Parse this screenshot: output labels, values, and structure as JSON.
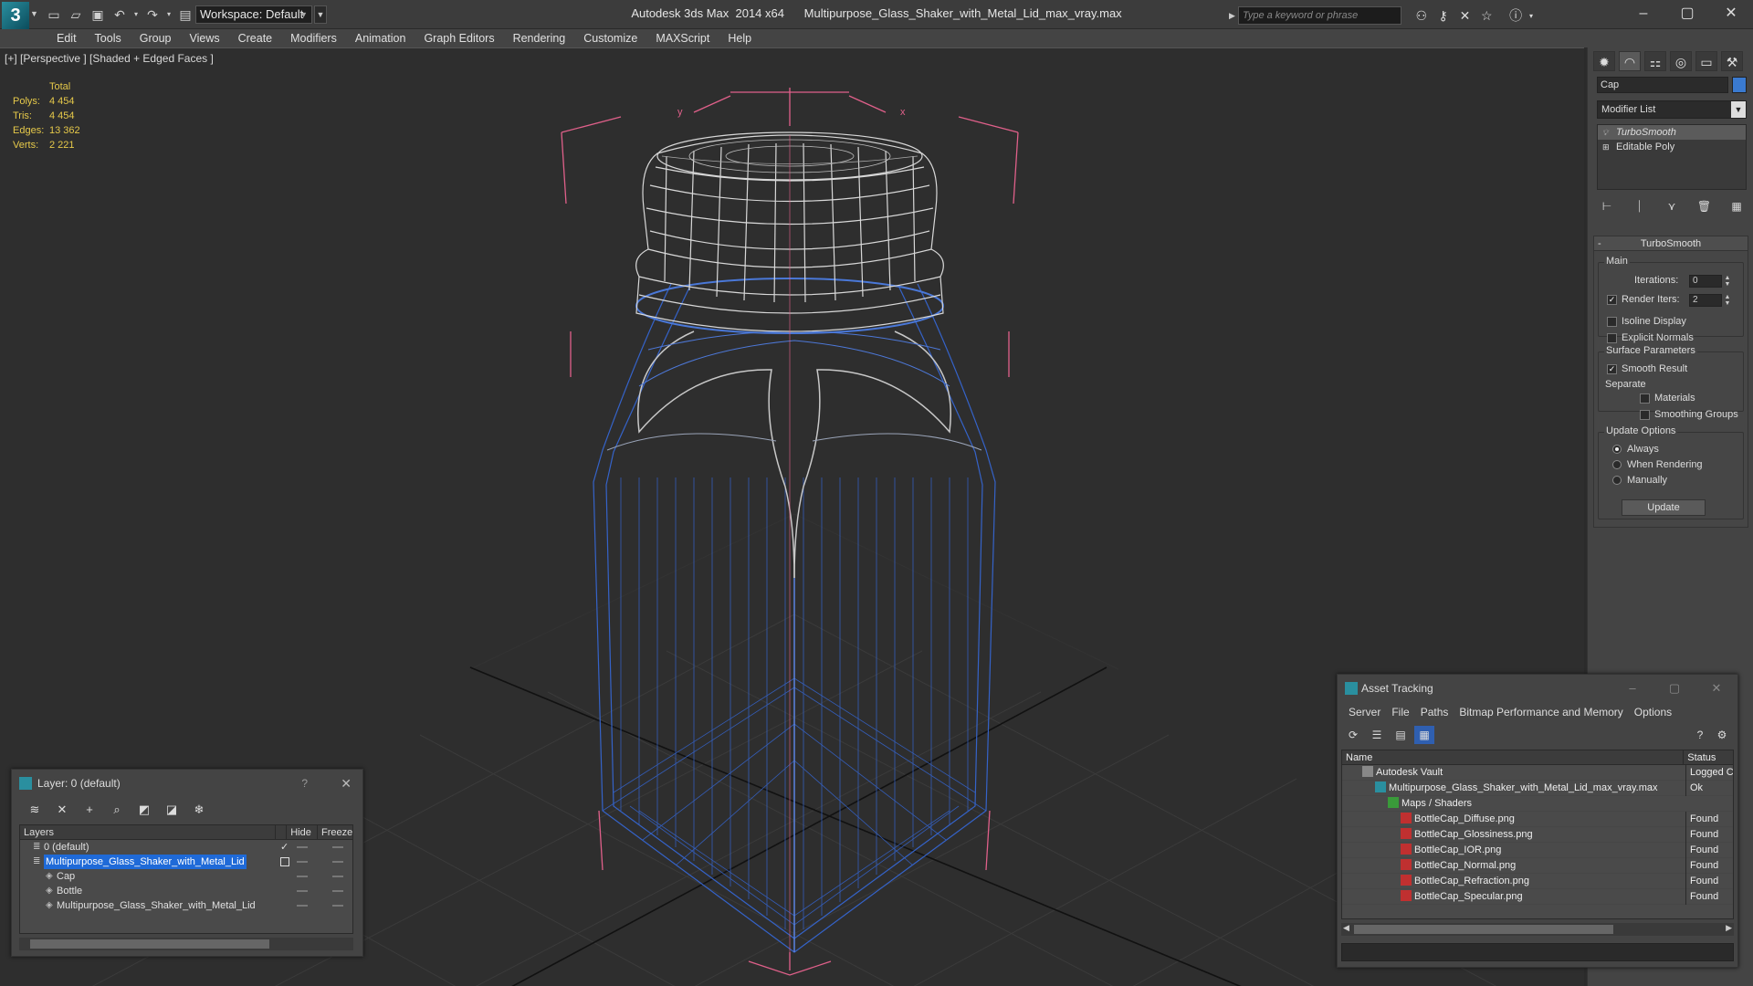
{
  "app": {
    "logo": "3",
    "title": "Autodesk 3ds Max  2014 x64      Multipurpose_Glass_Shaker_with_Metal_Lid_max_vray.max",
    "workspace": "Workspace: Default",
    "search_placeholder": "Type a keyword or phrase"
  },
  "menu": [
    "Edit",
    "Tools",
    "Group",
    "Views",
    "Create",
    "Modifiers",
    "Animation",
    "Graph Editors",
    "Rendering",
    "Customize",
    "MAXScript",
    "Help"
  ],
  "viewport": {
    "label": "[+] [Perspective ] [Shaded + Edged Faces ]",
    "stats": {
      "header": "Total",
      "rows": [
        {
          "k": "Polys:",
          "v": "4 454"
        },
        {
          "k": "Tris:",
          "v": "4 454"
        },
        {
          "k": "Edges:",
          "v": "13 362"
        },
        {
          "k": "Verts:",
          "v": "2 221"
        }
      ]
    },
    "axis_x": "x",
    "axis_y": "y"
  },
  "command_panel": {
    "object_name": "Cap",
    "modifier_list": "Modifier List",
    "stack": [
      "TurboSmooth",
      "Editable Poly"
    ],
    "turbosmooth": {
      "title": "TurboSmooth",
      "main": "Main",
      "iterations_label": "Iterations:",
      "iterations": "0",
      "render_iters_label": "Render Iters:",
      "render_iters": "2",
      "isoline": "Isoline Display",
      "explicit": "Explicit Normals",
      "surface": "Surface Parameters",
      "smooth_result": "Smooth Result",
      "separate": "Separate",
      "materials": "Materials",
      "smoothing_groups": "Smoothing Groups",
      "update_options": "Update Options",
      "always": "Always",
      "when_rendering": "When Rendering",
      "manually": "Manually",
      "update": "Update"
    }
  },
  "layer_dialog": {
    "title": "Layer: 0 (default)",
    "help": "?",
    "columns": [
      "Layers",
      "Hide",
      "Freeze"
    ],
    "rows": [
      {
        "name": "0 (default)",
        "indent": 1
      },
      {
        "name": "Multipurpose_Glass_Shaker_with_Metal_Lid",
        "indent": 1,
        "selected": true
      },
      {
        "name": "Cap",
        "indent": 2
      },
      {
        "name": "Bottle",
        "indent": 2
      },
      {
        "name": "Multipurpose_Glass_Shaker_with_Metal_Lid",
        "indent": 2
      }
    ]
  },
  "asset_dialog": {
    "title": "Asset Tracking",
    "menu": [
      "Server",
      "File",
      "Paths",
      "Bitmap Performance and Memory",
      "Options"
    ],
    "columns": [
      "Name",
      "Status"
    ],
    "rows": [
      {
        "name": "Autodesk Vault",
        "indent": 1,
        "status": "Logged C",
        "icon": "vault-icon"
      },
      {
        "name": "Multipurpose_Glass_Shaker_with_Metal_Lid_max_vray.max",
        "indent": 2,
        "status": "Ok",
        "icon": "max-file-icon"
      },
      {
        "name": "Maps / Shaders",
        "indent": 3,
        "status": "",
        "icon": "maps-icon"
      },
      {
        "name": "BottleCap_Diffuse.png",
        "indent": 4,
        "status": "Found",
        "icon": "png-icon"
      },
      {
        "name": "BottleCap_Glossiness.png",
        "indent": 4,
        "status": "Found",
        "icon": "png-icon"
      },
      {
        "name": "BottleCap_IOR.png",
        "indent": 4,
        "status": "Found",
        "icon": "png-icon"
      },
      {
        "name": "BottleCap_Normal.png",
        "indent": 4,
        "status": "Found",
        "icon": "png-icon"
      },
      {
        "name": "BottleCap_Refraction.png",
        "indent": 4,
        "status": "Found",
        "icon": "png-icon"
      },
      {
        "name": "BottleCap_Specular.png",
        "indent": 4,
        "status": "Found",
        "icon": "png-icon"
      }
    ]
  },
  "colors": {
    "selection": "#1f6ad8",
    "wire_blue": "#3563c9",
    "stats_yellow": "#e6c94a",
    "bbox_pink": "#e0608a"
  }
}
